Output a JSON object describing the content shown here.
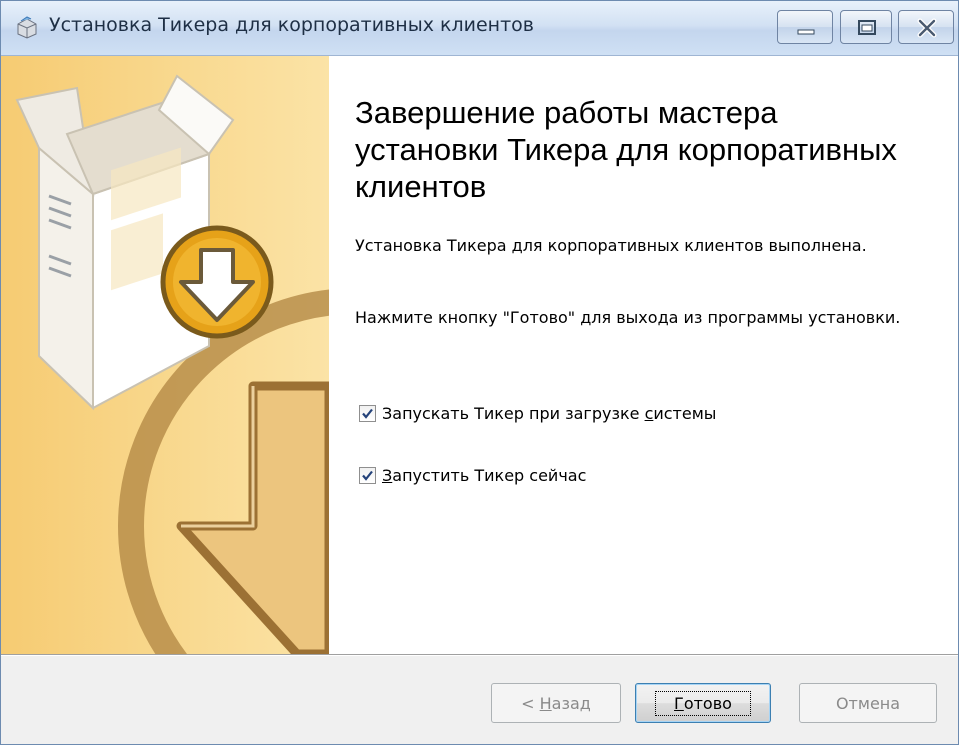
{
  "window": {
    "title": "Установка Тикера для корпоративных клиентов",
    "controls": {
      "minimize_icon": "minimize-icon",
      "maximize_icon": "maximize-icon",
      "close_icon": "close-icon"
    }
  },
  "wizard": {
    "heading": "Завершение работы мастера установки Тикера для корпоративных клиентов",
    "message": "Установка Тикера для корпоративных клиентов выполнена.",
    "instruction": "Нажмите кнопку \"Готово\" для выхода из программы установки.",
    "options": [
      {
        "label_before": "Запускать Тикер при загрузке ",
        "mnemonic": "с",
        "label_after": "истемы",
        "checked": true
      },
      {
        "label_before": "",
        "mnemonic": "З",
        "label_after": "апустить Тикер сейчас",
        "checked": true
      }
    ]
  },
  "buttons": {
    "back": {
      "prefix": "< ",
      "mnemonic": "Н",
      "rest": "азад",
      "enabled": false
    },
    "finish": {
      "mnemonic": "Г",
      "rest": "отово",
      "enabled": true,
      "default": true
    },
    "cancel": {
      "label": "Отмена",
      "enabled": false
    }
  },
  "colors": {
    "art_background": "#f8d68a",
    "art_accent": "#9a6e2a",
    "badge": "#e8a20f",
    "titlebar": "#d2e1f3",
    "footer": "#f0f0f0"
  }
}
